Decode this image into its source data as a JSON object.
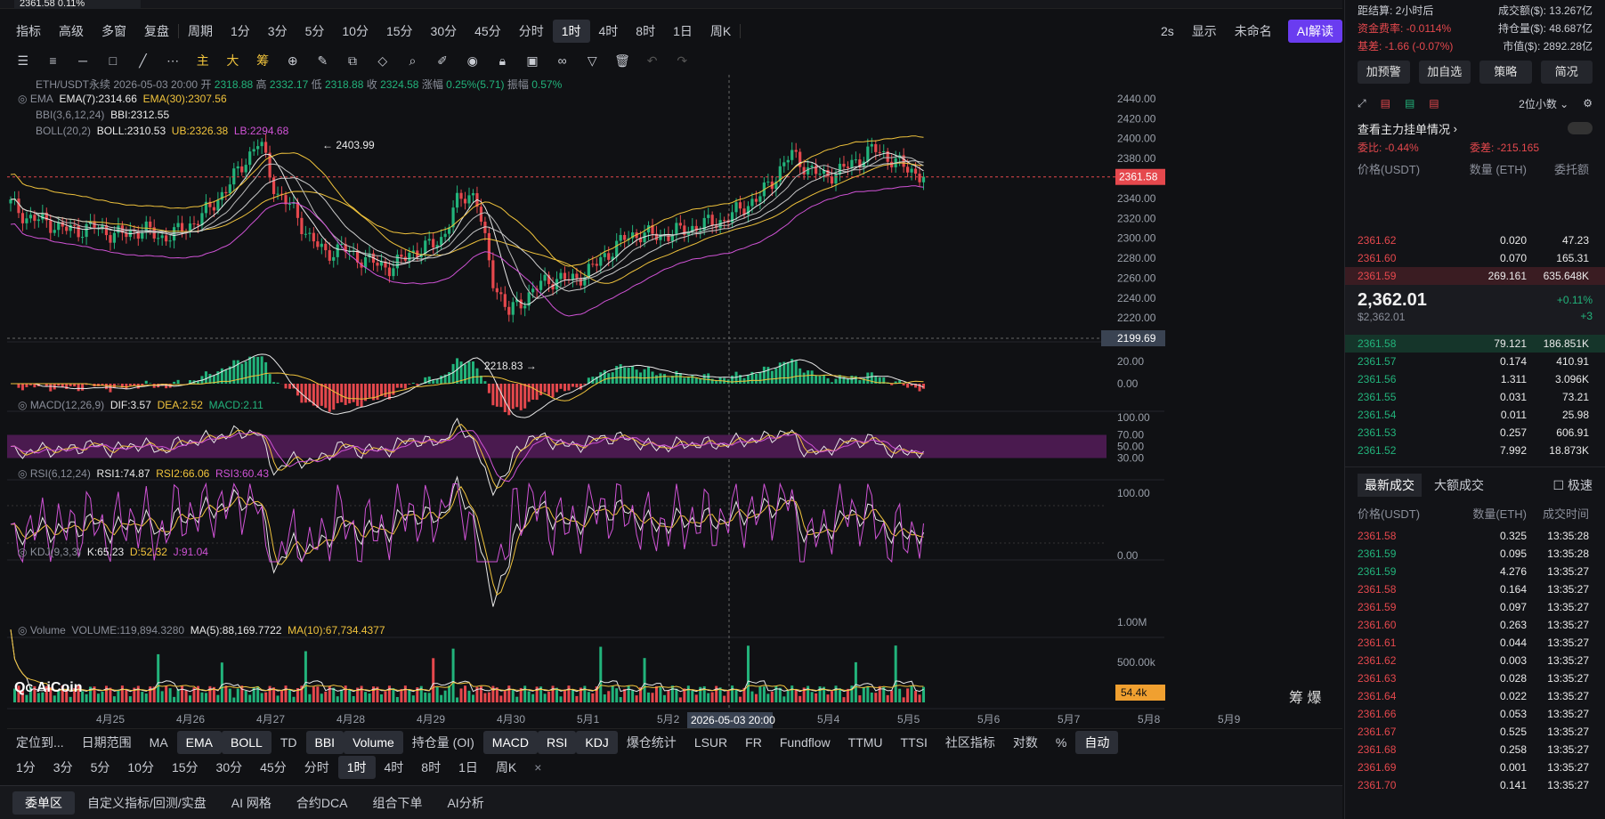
{
  "ticker": {
    "price": "2361.58",
    "change": "0.11%"
  },
  "toolbar1": {
    "items": [
      "指标",
      "高级",
      "多窗",
      "复盘",
      "周期",
      "1分",
      "3分",
      "5分",
      "10分",
      "15分",
      "30分",
      "45分",
      "分时",
      "1时",
      "4时",
      "8时",
      "1日",
      "周K",
      "2s",
      "显示",
      "未命名",
      "AI解读"
    ],
    "active": "1时"
  },
  "legend": {
    "title": "ETH/USDT永续  2026-05-03 20:00",
    "open_l": "开",
    "open": "2318.88",
    "high_l": "高",
    "high": "2332.17",
    "low_l": "低",
    "low": "2318.88",
    "close_l": "收",
    "close": "2324.58",
    "chg_l": "涨幅",
    "chg": "0.25%(5.71)",
    "amp_l": "振幅",
    "amp": "0.57%",
    "ema_l": "EMA",
    "ema7": "EMA(7):2314.66",
    "ema30": "EMA(30):2307.56",
    "bbi_l": "BBI(3,6,12,24)",
    "bbi": "BBI:2312.55",
    "boll_l": "BOLL(20,2)",
    "boll": "BOLL:2310.53",
    "ub": "UB:2326.38",
    "lb": "LB:2294.68",
    "macd_l": "MACD(12,26,9)",
    "dif": "DIF:3.57",
    "dea": "DEA:2.52",
    "macd": "MACD:2.11",
    "rsi_l": "RSI(6,12,24)",
    "rsi1": "RSI1:74.87",
    "rsi2": "RSI2:66.06",
    "rsi3": "RSI3:60.43",
    "kdj_l": "KDJ(9,3,3)",
    "k": "K:65.23",
    "d": "D:52.32",
    "j": "J:91.04",
    "vol_l": "Volume",
    "vol": "VOLUME:119,894.3280",
    "ma5": "MA(5):88,169.7722",
    "ma10": "MA(10):67,734.4377",
    "hi_mark": "2403.99",
    "lo_mark": "2218.83",
    "cross_price": "2199.69",
    "cross_time": "2026-05-03 20:00",
    "last_price": "2361.58",
    "vol_last": "54.4k"
  },
  "chart_data": {
    "type": "candlestick",
    "x_ticks": [
      "4月25",
      "4月26",
      "4月27",
      "4月28",
      "4月29",
      "4月30",
      "5月1",
      "5月2",
      "5月3",
      "5月4",
      "5月5",
      "5月6",
      "5月7",
      "5月8",
      "5月9"
    ],
    "price_axis": [
      "2440.00",
      "2420.00",
      "2400.00",
      "2380.00",
      "2360.00",
      "2340.00",
      "2320.00",
      "2300.00",
      "2280.00",
      "2260.00",
      "2240.00",
      "2220.00"
    ],
    "price_ylim": [
      2205,
      2448
    ],
    "close_path": [
      2335,
      2320,
      2318,
      2310,
      2308,
      2312,
      2305,
      2304,
      2310,
      2300,
      2306,
      2315,
      2330,
      2350,
      2375,
      2398,
      2345,
      2330,
      2300,
      2285,
      2290,
      2280,
      2275,
      2270,
      2285,
      2290,
      2300,
      2340,
      2345,
      2260,
      2225,
      2240,
      2255,
      2260,
      2258,
      2270,
      2285,
      2300,
      2305,
      2302,
      2306,
      2310,
      2315,
      2318,
      2330,
      2340,
      2360,
      2385,
      2370,
      2362,
      2368,
      2378,
      2390,
      2380,
      2370,
      2362
    ],
    "macd_axis": [
      "20.00",
      "0.00"
    ],
    "rsi_axis": [
      "100.00",
      "70.00",
      "50.00",
      "30.00"
    ],
    "kdj_axis": [
      "100.00",
      "0.00"
    ],
    "vol_axis": [
      "1.00M",
      "500.00k"
    ]
  },
  "bottom": {
    "left1": "定位到...",
    "left2": "日期范围",
    "inds": [
      "MA",
      "EMA",
      "BOLL",
      "TD",
      "BBI",
      "Volume",
      "持仓量 (OI)",
      "MACD",
      "RSI",
      "KDJ",
      "爆仓统计",
      "LSUR",
      "FR",
      "Fundflow",
      "TTMU",
      "TTSI",
      "社区指标",
      "对数",
      "%",
      "自动"
    ],
    "periods": [
      "1分",
      "3分",
      "5分",
      "10分",
      "15分",
      "30分",
      "45分",
      "分时",
      "1时",
      "4时",
      "8时",
      "1日",
      "周K"
    ]
  },
  "footer": [
    "委单区",
    "自定义指标/回测/实盘",
    "AI 网格",
    "合约DCA",
    "组合下单",
    "AI分析"
  ],
  "right": {
    "stats": [
      [
        "距结算: 2小时后",
        "成交额($): 13.267亿"
      ],
      [
        "资金费率: -0.0114%",
        "持仓量($): 48.687亿"
      ],
      [
        "基差: -1.66 (-0.07%)",
        "市值($): 2892.28亿"
      ]
    ],
    "buttons": [
      "加预警",
      "加自选",
      "策略",
      "简况"
    ],
    "decimals": "2位小数",
    "main_order": "查看主力挂单情况",
    "ratio": "委比: -0.44%",
    "diff": "委差: -215.165",
    "ob_head": [
      "价格(USDT)",
      "数量 (ETH)",
      "委托额"
    ],
    "asks": [
      [
        "2361.62",
        "0.020",
        "47.23"
      ],
      [
        "2361.60",
        "0.070",
        "165.31"
      ],
      [
        "2361.59",
        "269.161",
        "635.648K"
      ]
    ],
    "mid_price": "2,362.01",
    "mid_usd": "$2,362.01",
    "mid_chg": "+0.11%",
    "mid_diff": "+3",
    "bids": [
      [
        "2361.58",
        "79.121",
        "186.851K"
      ],
      [
        "2361.57",
        "0.174",
        "410.91"
      ],
      [
        "2361.56",
        "1.311",
        "3.096K"
      ],
      [
        "2361.55",
        "0.031",
        "73.21"
      ],
      [
        "2361.54",
        "0.011",
        "25.98"
      ],
      [
        "2361.53",
        "0.257",
        "606.91"
      ],
      [
        "2361.52",
        "7.992",
        "18.873K"
      ]
    ],
    "trade_tabs": [
      "最新成交",
      "大额成交",
      "极速"
    ],
    "trade_head": [
      "价格(USDT)",
      "数量(ETH)",
      "成交时间"
    ],
    "trades": [
      [
        "2361.58",
        "0.325",
        "13:35:28",
        "r"
      ],
      [
        "2361.59",
        "0.095",
        "13:35:28",
        "g"
      ],
      [
        "2361.59",
        "4.276",
        "13:35:27",
        "g"
      ],
      [
        "2361.58",
        "0.164",
        "13:35:27",
        "r"
      ],
      [
        "2361.59",
        "0.097",
        "13:35:27",
        "r"
      ],
      [
        "2361.60",
        "0.263",
        "13:35:27",
        "r"
      ],
      [
        "2361.61",
        "0.044",
        "13:35:27",
        "r"
      ],
      [
        "2361.62",
        "0.003",
        "13:35:27",
        "r"
      ],
      [
        "2361.63",
        "0.028",
        "13:35:27",
        "r"
      ],
      [
        "2361.64",
        "0.022",
        "13:35:27",
        "r"
      ],
      [
        "2361.66",
        "0.053",
        "13:35:27",
        "r"
      ],
      [
        "2361.67",
        "0.525",
        "13:35:27",
        "r"
      ],
      [
        "2361.68",
        "0.258",
        "13:35:27",
        "r"
      ],
      [
        "2361.69",
        "0.001",
        "13:35:27",
        "r"
      ],
      [
        "2361.70",
        "0.141",
        "13:35:27",
        "r"
      ]
    ]
  },
  "colors": {
    "up": "#22b37b",
    "down": "#e5484d",
    "yellow": "#f0c33c",
    "pink": "#d053d6"
  }
}
